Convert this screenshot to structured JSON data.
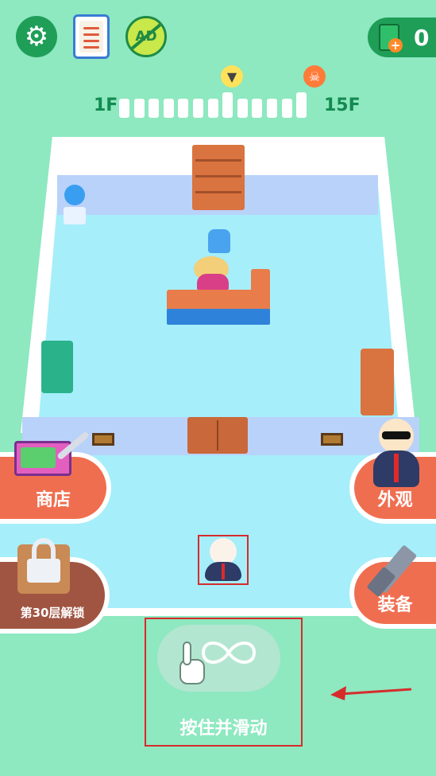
{
  "hud": {
    "settings_icon": "gear-icon",
    "tasks_icon": "notepad-icon",
    "no_ads_label": "AD",
    "cash_amount": "0"
  },
  "floor_progress": {
    "start_label": "1F",
    "end_label": "15F",
    "segments": 13,
    "weapon_marker_icon": "pistol-icon",
    "boss_marker_icon": "skull-icon"
  },
  "side_buttons": {
    "shop_label": "商店",
    "skin_label": "外观",
    "equip_label": "装备",
    "unlock_label": "第30层解锁"
  },
  "hint": {
    "text": "按住并滑动",
    "hand_icon": "hand-pointer-icon",
    "gesture_icon": "infinity-swipe-icon"
  },
  "colors": {
    "background": "#8ee8c0",
    "floor": "#a6eefa",
    "accent_button": "#f06e50",
    "hud_green": "#1f9e58",
    "annotation_red": "#d62c2c"
  }
}
